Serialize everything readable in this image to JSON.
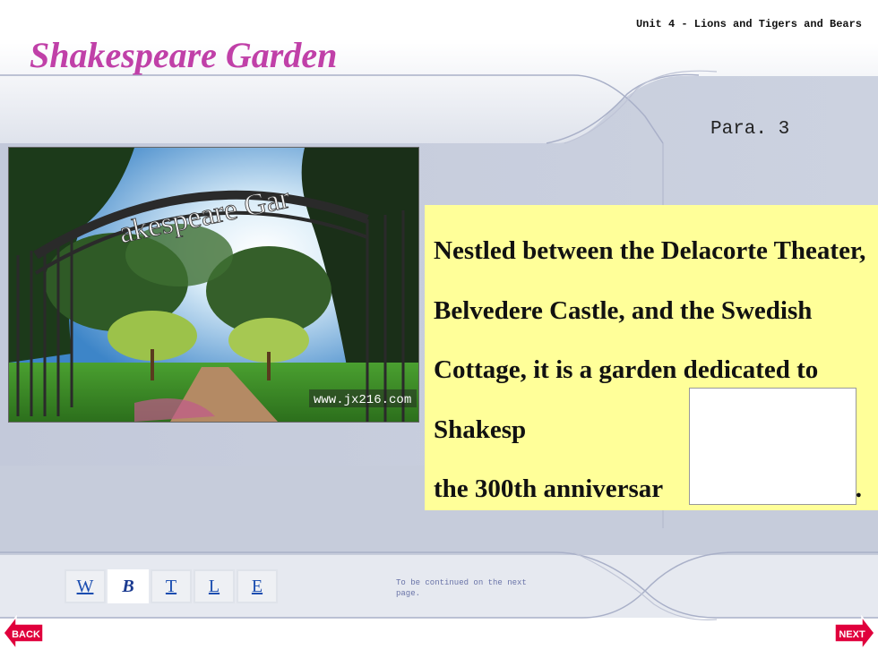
{
  "header": {
    "unit_label": "Unit 4 - Lions and Tigers and Bears",
    "title": "Shakespeare Garden"
  },
  "content": {
    "para_label": "Para. 3",
    "paragraph": "Nestled between the Delacorte Theater, Belvedere Castle, and the Swedish Cottage, it is a garden dedicated to Shakesp",
    "paragraph_line_end": "the 300th anniversar",
    "paragraph_trailing": "."
  },
  "photo": {
    "arch_text": "akespeare Gar",
    "watermark": "www.jx216.com"
  },
  "footer": {
    "nav_letters": [
      {
        "label": "W"
      },
      {
        "label": "B"
      },
      {
        "label": "T"
      },
      {
        "label": "L"
      },
      {
        "label": "E"
      }
    ],
    "continued_note": "To be continued on the next page.",
    "back_label": "BACK",
    "next_label": "NEXT"
  },
  "colors": {
    "title": "#c040a8",
    "text_box": "#ffff99",
    "panel": "#c8cedd",
    "arrow": "#e0003c"
  }
}
